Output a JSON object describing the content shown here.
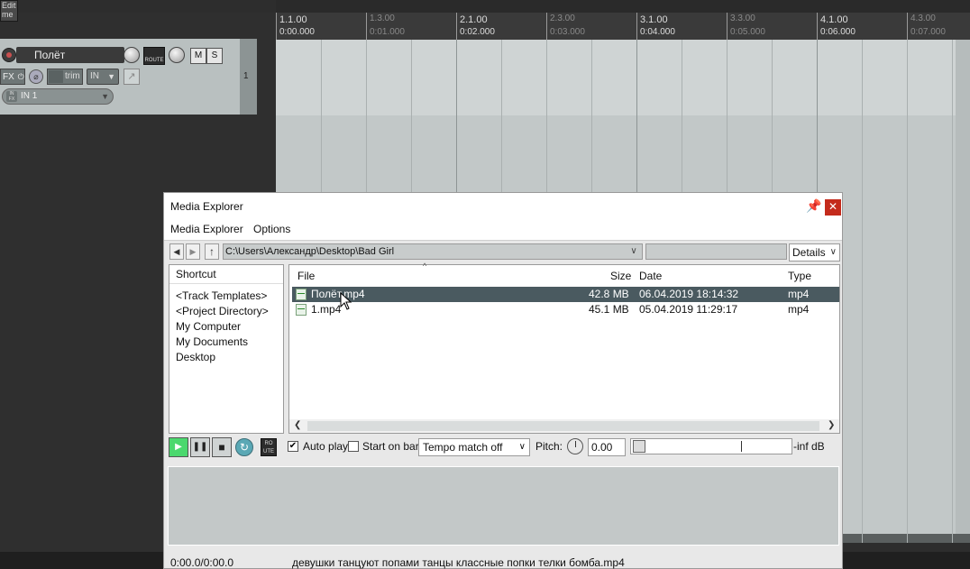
{
  "toolbar": {
    "edit_line1": "Edit",
    "edit_line2": "me"
  },
  "track": {
    "name": "Полёт",
    "route_label": "ROUTE",
    "mute_label": "M",
    "solo_label": "S",
    "fx_label": "FX",
    "trim_label": "trim",
    "input_mode": "IN",
    "input_name": "IN 1",
    "number": "1"
  },
  "ruler": {
    "bars": [
      {
        "label": "1.1.00",
        "time": "0:00.000",
        "major": true
      },
      {
        "label": "1.3.00",
        "time": "0:01.000",
        "major": false
      },
      {
        "label": "2.1.00",
        "time": "0:02.000",
        "major": true
      },
      {
        "label": "2.3.00",
        "time": "0:03.000",
        "major": false
      },
      {
        "label": "3.1.00",
        "time": "0:04.000",
        "major": true
      },
      {
        "label": "3.3.00",
        "time": "0:05.000",
        "major": false
      },
      {
        "label": "4.1.00",
        "time": "0:06.000",
        "major": true
      },
      {
        "label": "4.3.00",
        "time": "0:07.000",
        "major": false
      }
    ]
  },
  "media_explorer": {
    "title": "Media Explorer",
    "menu": [
      "Media Explorer",
      "Options"
    ],
    "path": "C:\\Users\\Александр\\Desktop\\Bad Girl",
    "search_value": "",
    "view_mode": "Details",
    "shortcut_header": "Shortcut",
    "shortcuts": [
      "<Track Templates>",
      "<Project Directory>",
      "My Computer",
      "My Documents",
      "Desktop"
    ],
    "columns": {
      "file": "File",
      "size": "Size",
      "date": "Date",
      "type": "Type"
    },
    "files": [
      {
        "name": "Полёт.mp4",
        "size": "42.8 MB",
        "date": "06.04.2019 18:14:32",
        "type": "mp4",
        "selected": true
      },
      {
        "name": "1.mp4",
        "size": "45.1 MB",
        "date": "05.04.2019 11:29:17",
        "type": "mp4",
        "selected": false
      }
    ],
    "transport": {
      "route_label": "RO UTE",
      "auto_play_label": "Auto play",
      "auto_play_checked": true,
      "start_on_bar_label": "Start on bar",
      "start_on_bar_checked": false,
      "tempo_match": "Tempo match off",
      "pitch_label": "Pitch:",
      "pitch_value": "0.00",
      "volume_readout": "-inf dB"
    },
    "status": {
      "time": "0:00.0/0:00.0",
      "file": "девушки танцуют попами танцы классные попки телки бомба.mp4"
    }
  },
  "colors": {
    "play_button": "#4bd86e",
    "selected_row": "#4a5a60",
    "close_button": "#c42b1c",
    "arrange_bg": "#c2c8c8"
  }
}
